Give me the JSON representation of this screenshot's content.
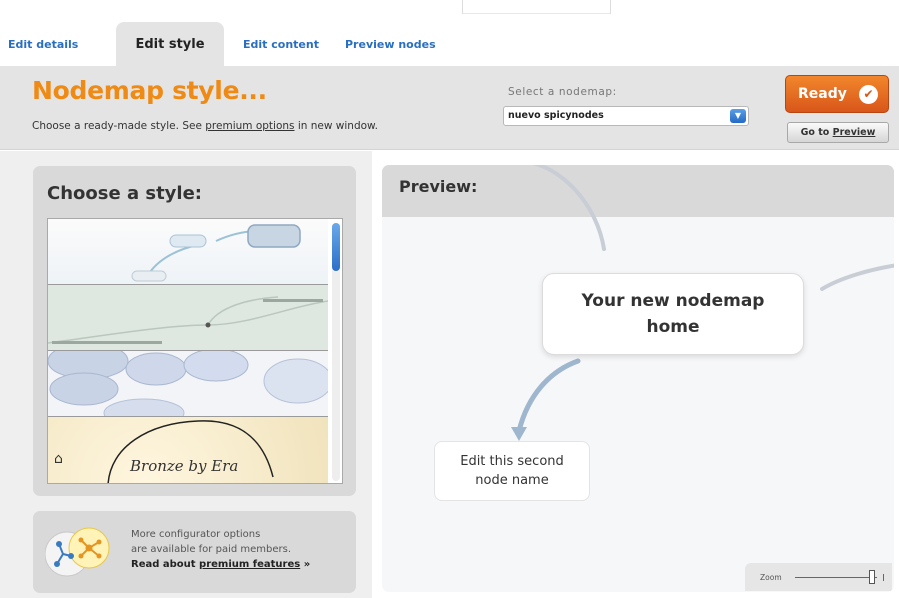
{
  "tabs": [
    {
      "label": "Edit details"
    },
    {
      "label": "Edit style"
    },
    {
      "label": "Edit content"
    },
    {
      "label": "Preview nodes"
    }
  ],
  "header": {
    "title": "Nodemap style...",
    "subtitle_before": "Choose a ready-made style. See ",
    "subtitle_link": "premium options",
    "subtitle_after": " in new window.",
    "nodemap_label": "Select a nodemap:",
    "nodemap_value": "nuevo spicynodes",
    "ready_label": "Ready",
    "goto_prefix": "Go to ",
    "goto_link": "Preview"
  },
  "style_panel": {
    "title": "Choose a style:",
    "thumb_script_text": "Bronze by Era"
  },
  "promo": {
    "line1": "More configurator options",
    "line2": "are available for paid members.",
    "link_prefix": "Read about ",
    "link_text": "premium features",
    "link_suffix": " »"
  },
  "preview": {
    "title": "Preview:",
    "home_node": "Your new nodemap home",
    "second_node": "Edit this second node name",
    "zoom_label": "Zoom"
  },
  "colors": {
    "accent_orange": "#ef8a14",
    "ready_button": "#e06a22",
    "tab_link": "#2a6fbf",
    "panel_gray": "#d9d9d9"
  },
  "icons": {
    "select_arrow": "chevron-down-icon",
    "ready_check": "check-icon",
    "promo": "nodes-icon",
    "thumb_home": "home-icon"
  }
}
